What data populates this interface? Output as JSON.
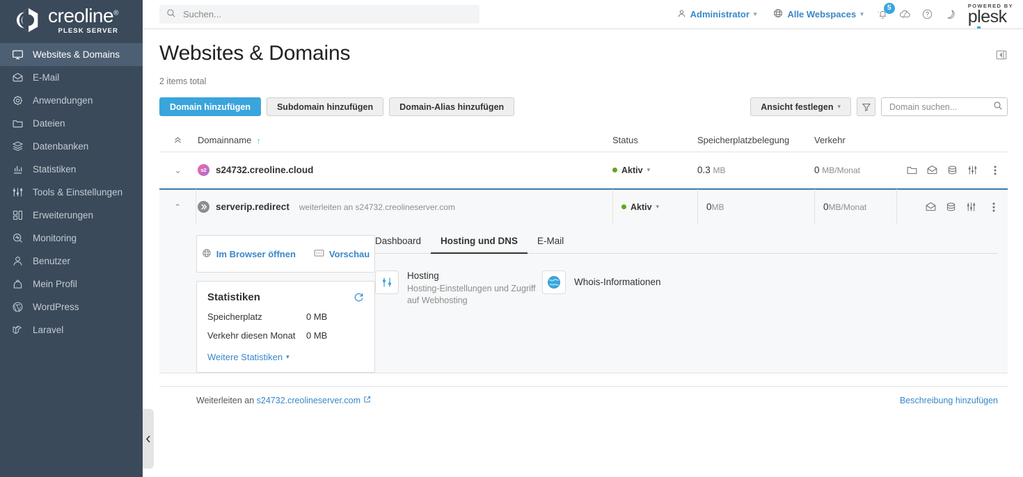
{
  "brand": {
    "name": "creoline",
    "trademark": "®",
    "subtitle": "PLESK SERVER"
  },
  "sidebar": {
    "items": [
      {
        "label": "Websites & Domains",
        "icon": "monitor-icon",
        "active": true
      },
      {
        "label": "E-Mail",
        "icon": "envelope-icon",
        "active": false
      },
      {
        "label": "Anwendungen",
        "icon": "gear-icon",
        "active": false
      },
      {
        "label": "Dateien",
        "icon": "folder-icon",
        "active": false
      },
      {
        "label": "Datenbanken",
        "icon": "database-icon",
        "active": false
      },
      {
        "label": "Statistiken",
        "icon": "bar-chart-icon",
        "active": false
      },
      {
        "label": "Tools & Einstellungen",
        "icon": "sliders-icon",
        "active": false
      },
      {
        "label": "Erweiterungen",
        "icon": "extensions-icon",
        "active": false
      },
      {
        "label": "Monitoring",
        "icon": "monitoring-icon",
        "active": false
      },
      {
        "label": "Benutzer",
        "icon": "user-icon",
        "active": false
      },
      {
        "label": "Mein Profil",
        "icon": "profile-icon",
        "active": false
      },
      {
        "label": "WordPress",
        "icon": "wordpress-icon",
        "active": false
      },
      {
        "label": "Laravel",
        "icon": "laravel-icon",
        "active": false
      }
    ]
  },
  "topbar": {
    "search_placeholder": "Suchen...",
    "search_value": "",
    "user_label": "Administrator",
    "webspace_label": "Alle Webspaces",
    "notifications_count": "5",
    "plesk_powered_by": "POWERED BY",
    "plesk_name": "plesk"
  },
  "page": {
    "title": "Websites & Domains",
    "items_total": "2 items total"
  },
  "toolbar": {
    "add_domain": "Domain hinzufügen",
    "add_subdomain": "Subdomain hinzufügen",
    "add_domain_alias": "Domain-Alias hinzufügen",
    "set_view": "Ansicht festlegen",
    "domain_search_placeholder": "Domain suchen...",
    "domain_search_value": ""
  },
  "table": {
    "headers": {
      "name": "Domainname",
      "status": "Status",
      "space": "Speicherplatzbelegung",
      "traffic": "Verkehr"
    },
    "sort_indicator": "↑",
    "rows": [
      {
        "name": "s24732.creoline.cloud",
        "subtitle": "",
        "avatar_text": "s2",
        "icon": "domain-avatar-icon",
        "status": "Aktiv",
        "status_color": "#62a420",
        "space_value": "0.3",
        "space_unit": "MB",
        "traffic_value": "0",
        "traffic_unit": "MB/Monat",
        "actions": [
          "folder-icon",
          "envelope-icon",
          "database-icon",
          "sliders-icon",
          "kebab-menu-icon"
        ],
        "expanded": false
      },
      {
        "name": "serverip.redirect",
        "subtitle": "weiterleiten an s24732.creolineserver.com",
        "avatar_text": "",
        "icon": "redirect-icon",
        "status": "Aktiv",
        "status_color": "#62a420",
        "space_value": "0",
        "space_unit": "MB",
        "traffic_value": "0",
        "traffic_unit": "MB/Monat",
        "actions": [
          "envelope-icon",
          "database-icon",
          "sliders-icon",
          "kebab-menu-icon"
        ],
        "expanded": true
      }
    ]
  },
  "panel": {
    "open_in_browser": "Im Browser öffnen",
    "preview": "Vorschau",
    "stats_title": "Statistiken",
    "stats": [
      {
        "label": "Speicherplatz",
        "value": "0 MB"
      },
      {
        "label": "Verkehr diesen Monat",
        "value": "0 MB"
      }
    ],
    "more_stats": "Weitere Statistiken",
    "tabs": [
      {
        "label": "Dashboard",
        "active": false
      },
      {
        "label": "Hosting und DNS",
        "active": true
      },
      {
        "label": "E-Mail",
        "active": false
      }
    ],
    "features": [
      {
        "title": "Hosting",
        "desc": "Hosting-Einstellungen und Zugriff auf Webhosting",
        "icon": "sliders-icon"
      },
      {
        "title": "Whois-Informationen",
        "desc": "",
        "icon": "globe-icon"
      }
    ],
    "footer_prefix": "Weiterleiten an",
    "footer_link": "s24732.creolineserver.com",
    "footer_right": "Beschreibung hinzufügen"
  }
}
